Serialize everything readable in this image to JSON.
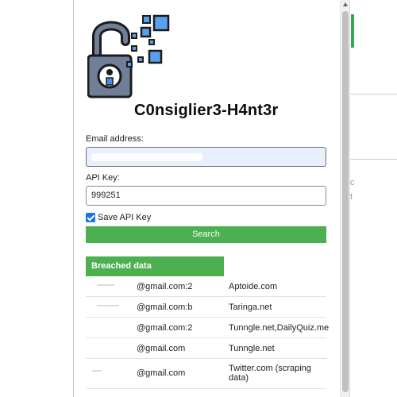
{
  "colors": {
    "accent_green": "#4caf50",
    "title_text": "#0d0d0d",
    "input_focus_bg": "#e8f0fe",
    "checkbox_blue": "#1a73e8"
  },
  "header": {
    "title": "C0nsiglier3-H4nt3r",
    "logo_icon": "unlocked-padlock-icon"
  },
  "form": {
    "email_label": "Email address:",
    "email_value": "",
    "api_key_label": "API Key:",
    "api_key_value": "999251",
    "save_api_key_label": "Save API Key",
    "save_api_key_checked": true,
    "search_label": "Search"
  },
  "breaches": {
    "header": "Breached data",
    "rows": [
      {
        "email": "@gmail.com:2",
        "site": "Aptoide.com"
      },
      {
        "email": "@gmail.com:b",
        "site": "Taringa.net"
      },
      {
        "email": "@gmail.com:2",
        "site": "Tunngle.net,DailyQuiz.me"
      },
      {
        "email": "@gmail.com",
        "site": "Tunngle.net"
      },
      {
        "email": "@gmail.com",
        "site": "Twitter.com (scraping data)"
      }
    ]
  }
}
